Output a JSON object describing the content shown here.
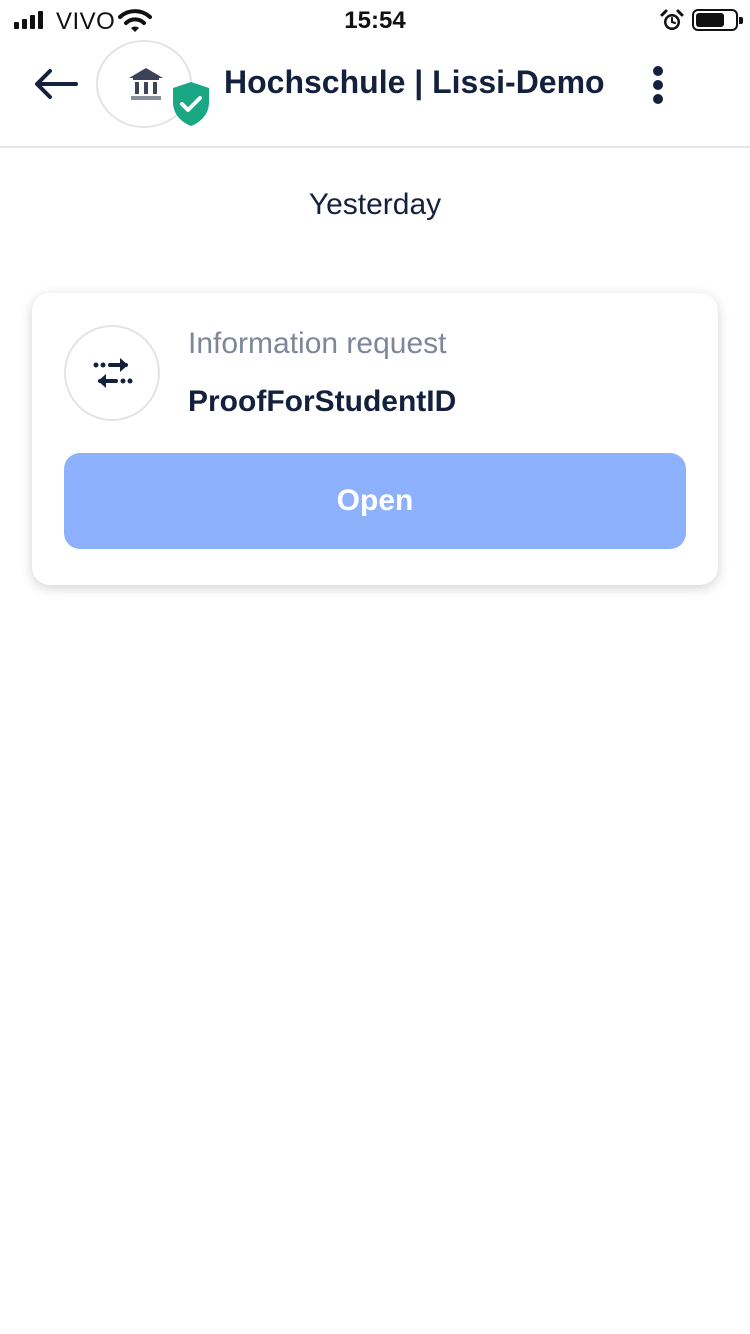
{
  "status_bar": {
    "carrier": "VIVO",
    "time": "15:54",
    "icons": [
      "signal-icon",
      "wifi-icon",
      "alarm-icon",
      "battery-icon"
    ],
    "battery_level": 0.65
  },
  "header": {
    "title": "Hochschule | Lissi-Demo",
    "back_icon": "arrow-left-icon",
    "avatar_icon": "bank-icon",
    "verified_icon": "shield-check-icon",
    "menu_icon": "more-vertical-icon"
  },
  "timeline": {
    "date_label": "Yesterday",
    "items": [
      {
        "type": "Information request",
        "name": "ProofForStudentID",
        "icon": "exchange-arrows-icon",
        "action_label": "Open"
      }
    ]
  },
  "colors": {
    "primary_text": "#14213d",
    "secondary_text": "#7c8799",
    "button": "#8db1fc",
    "verified": "#1aa884"
  }
}
